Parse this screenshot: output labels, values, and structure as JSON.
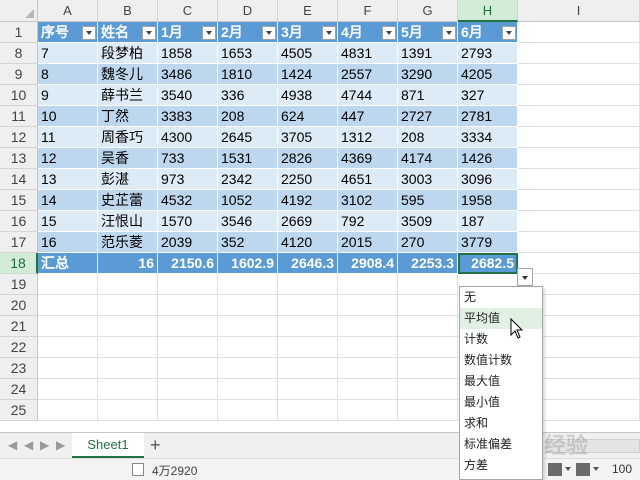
{
  "columns": [
    "A",
    "B",
    "C",
    "D",
    "E",
    "F",
    "G",
    "H",
    "I"
  ],
  "selected_column": "H",
  "header_row": {
    "row_number": "1",
    "cells": [
      "序号",
      "姓名",
      "1月",
      "2月",
      "3月",
      "4月",
      "5月",
      "6月"
    ]
  },
  "rows": [
    {
      "row_number": "8",
      "cells": [
        "7",
        "段梦柏",
        "1858",
        "1653",
        "4505",
        "4831",
        "1391",
        "2793"
      ]
    },
    {
      "row_number": "9",
      "cells": [
        "8",
        "魏冬儿",
        "3486",
        "1810",
        "1424",
        "2557",
        "3290",
        "4205"
      ]
    },
    {
      "row_number": "10",
      "cells": [
        "9",
        "薛书兰",
        "3540",
        "336",
        "4938",
        "4744",
        "871",
        "327"
      ]
    },
    {
      "row_number": "11",
      "cells": [
        "10",
        "丁然",
        "3383",
        "208",
        "624",
        "447",
        "2727",
        "2781"
      ]
    },
    {
      "row_number": "12",
      "cells": [
        "11",
        "周香巧",
        "4300",
        "2645",
        "3705",
        "1312",
        "208",
        "3334"
      ]
    },
    {
      "row_number": "13",
      "cells": [
        "12",
        "吴香",
        "733",
        "1531",
        "2826",
        "4369",
        "4174",
        "1426"
      ]
    },
    {
      "row_number": "14",
      "cells": [
        "13",
        "彭湛",
        "973",
        "2342",
        "2250",
        "4651",
        "3003",
        "3096"
      ]
    },
    {
      "row_number": "15",
      "cells": [
        "14",
        "史芷蕾",
        "4532",
        "1052",
        "4192",
        "3102",
        "595",
        "1958"
      ]
    },
    {
      "row_number": "16",
      "cells": [
        "15",
        "汪恨山",
        "1570",
        "3546",
        "2669",
        "792",
        "3509",
        "187"
      ]
    },
    {
      "row_number": "17",
      "cells": [
        "16",
        "范乐菱",
        "2039",
        "352",
        "4120",
        "2015",
        "270",
        "3779"
      ]
    }
  ],
  "total_row": {
    "row_number": "18",
    "cells": [
      "汇总",
      "16",
      "2150.6",
      "1602.9",
      "2646.3",
      "2908.4",
      "2253.3",
      "2682.5"
    ]
  },
  "empty_rows": [
    "19",
    "20",
    "21",
    "22",
    "23",
    "24",
    "25"
  ],
  "aggregate_menu": {
    "items": [
      "无",
      "平均值",
      "计数",
      "数值计数",
      "最大值",
      "最小值",
      "求和",
      "标准偏差",
      "方差"
    ],
    "hovered_index": 1
  },
  "sheet_tab": "Sheet1",
  "add_sheet_icon": "+",
  "status": {
    "selection_summary": "4万2920",
    "zoom": "100"
  },
  "watermark": "经验",
  "colors": {
    "table_header": "#5b9bd5",
    "band_light": "#ddebf7",
    "band_dark": "#bdd7ee",
    "excel_green": "#217346",
    "menu_hover": "#e0f0e3"
  },
  "icons": {
    "filter": "filter-dropdown-icon",
    "aggregate": "chevron-down-icon",
    "cursor": "mouse-pointer-icon",
    "sum": "sum-icon"
  }
}
